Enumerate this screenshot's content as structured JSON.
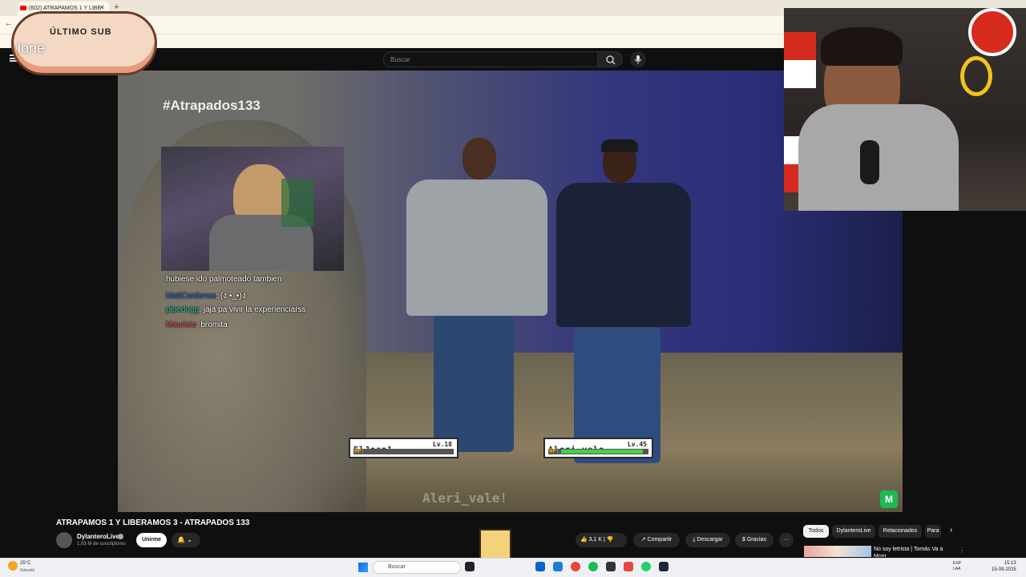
{
  "browser": {
    "tab_title": "(602) ATRAPAMOS 1 Y LIBE",
    "tab_close": "✕",
    "new_tab": "+",
    "back": "←"
  },
  "youtube": {
    "search_placeholder": "Buscar"
  },
  "overlay_sub": {
    "title": "ÚLTIMO SUB",
    "name": "lone"
  },
  "video": {
    "hashtag": "#Atrapados133",
    "chat": [
      {
        "user": "",
        "text": "hubiese ido palmoteado tambien",
        "color": "#ffffff"
      },
      {
        "user": "MatiCardenas",
        "text": "(ง •̀_•́)ง",
        "color": "#3a6cd4"
      },
      {
        "user": "pipedogg",
        "text": "jaja pa vivir la experienciarss",
        "color": "#2ec4a4"
      },
      {
        "user": "Mauricio",
        "text": "bromita",
        "color": "#e0506a"
      }
    ],
    "hp_left": {
      "name": "ElJean1",
      "level": "Lv.18",
      "hp_label": "HP:",
      "hp_fraction": 0.0
    },
    "hp_right": {
      "name": "Aleri_vale",
      "level": "Lv.45",
      "hp_label": "HP:",
      "hp_fraction": 0.95
    },
    "watermark": "Aleri_vale!",
    "logo": "M"
  },
  "below": {
    "title": "ATRAPAMOS 1 Y LIBERAMOS 3 - ATRAPADOS 133",
    "channel": "DylanteroLive",
    "subs": "1,03 M de suscriptores",
    "join": "Unirme",
    "bell": "🔔 ⌄",
    "likes": "👍 3,1 K  |  👎",
    "share": "↗ Compartir",
    "download": "⤓ Descargar",
    "thanks": "$ Gracias",
    "more": "···"
  },
  "chips": {
    "all": "Todos",
    "channel": "DylanteroLive",
    "related": "Relacionados",
    "for_you": "Para",
    "next": "›"
  },
  "recommendation": {
    "title": "No soy letrista | Tomás Va a Morir",
    "more": "⋮"
  },
  "taskbar": {
    "temp": "25°C",
    "weather": "Soleado",
    "search": "Buscar",
    "lang": "ESP\nLAA",
    "time": "15:13",
    "date": "15-09-2025"
  },
  "colors": {
    "youtube_bg": "#0f0f0f",
    "hp_green": "#48d048",
    "hp_label": "#f2b400"
  }
}
